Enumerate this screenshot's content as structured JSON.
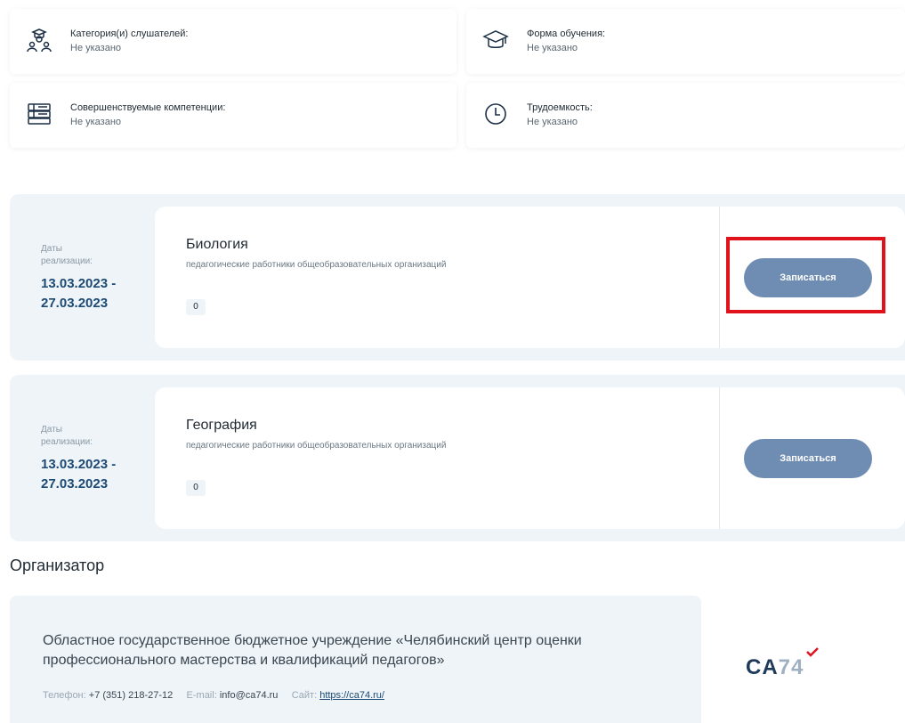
{
  "info": [
    {
      "label": "Категория(и) слушателей:",
      "value": "Не указано",
      "icon": "students-icon"
    },
    {
      "label": "Форма обучения:",
      "value": "Не указано",
      "icon": "graduation-cap-icon"
    },
    {
      "label": "Совершенствуемые компетенции:",
      "value": "Не указано",
      "icon": "books-icon"
    },
    {
      "label": "Трудоемкость:",
      "value": "Не указано",
      "icon": "clock-icon"
    }
  ],
  "sessions": [
    {
      "dates_label_1": "Даты",
      "dates_label_2": "реализации:",
      "date_start": "13.03.2023 -",
      "date_end": "27.03.2023",
      "title": "Биология",
      "subtitle": "педагогические работники общеобразовательных организаций",
      "count": "0",
      "button": "Записаться"
    },
    {
      "dates_label_1": "Даты",
      "dates_label_2": "реализации:",
      "date_start": "13.03.2023 -",
      "date_end": "27.03.2023",
      "title": "География",
      "subtitle": "педагогические работники общеобразовательных организаций",
      "count": "0",
      "button": "Записаться"
    }
  ],
  "organizer": {
    "heading": "Организатор",
    "name": "Областное государственное бюджетное учреждение «Челябинский центр оценки профессионального мастерства и квалификаций педагогов»",
    "phone_label": "Телефон:",
    "phone": "+7 (351) 218-27-12",
    "email_label": "E-mail:",
    "email": "info@ca74.ru",
    "site_label": "Сайт:",
    "site": "https://ca74.ru/",
    "logo_letters": "CA",
    "logo_number": "74"
  },
  "colors": {
    "accent": "#6f8db3",
    "highlight": "#e0121b",
    "date": "#1c4a74",
    "panel": "#eef4f7"
  }
}
